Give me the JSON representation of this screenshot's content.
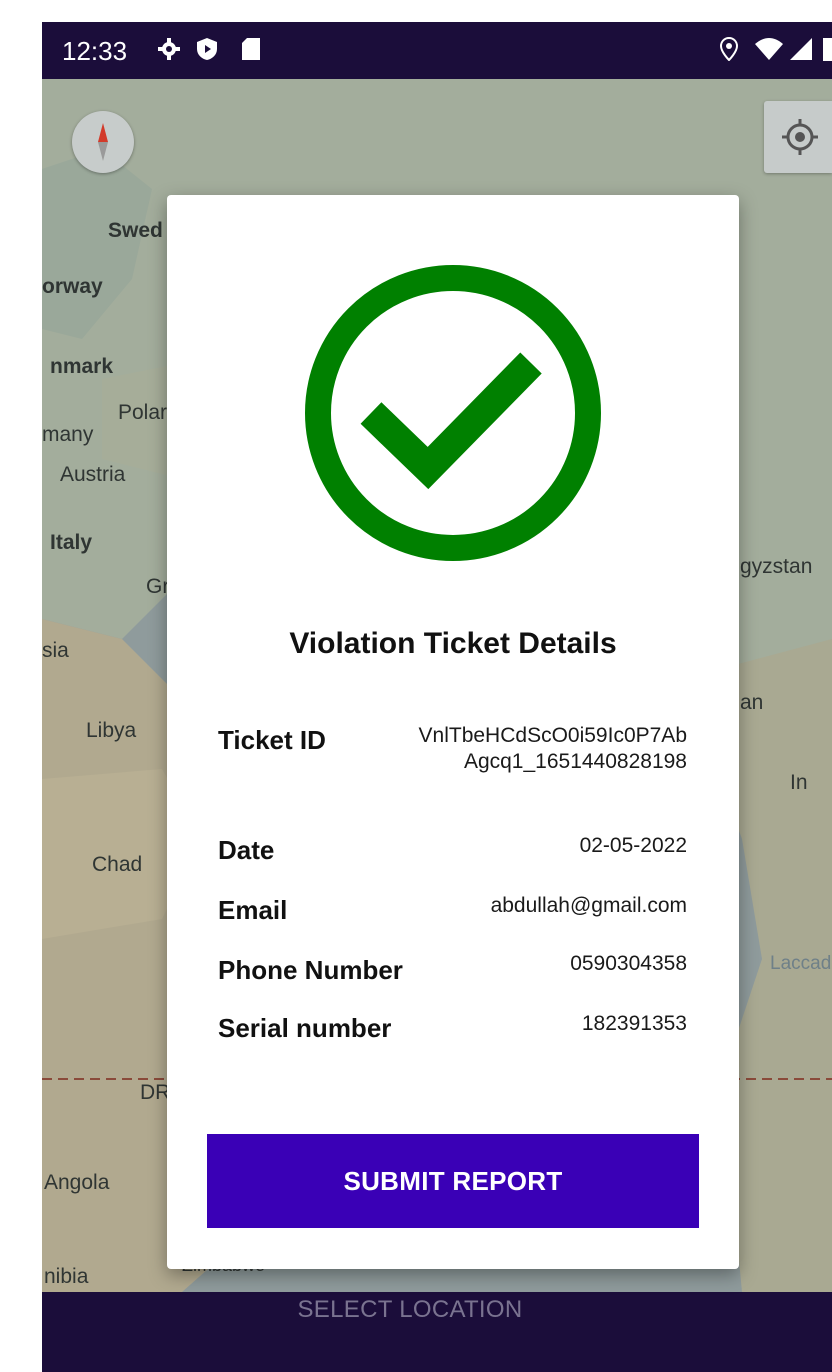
{
  "status_bar": {
    "time": "12:33",
    "icons": [
      "gear-icon",
      "shield-icon",
      "sd-card-icon",
      "location-icon",
      "wifi-icon",
      "signal-icon",
      "battery-icon"
    ]
  },
  "map": {
    "labels": [
      "Swed",
      "orway",
      "nmark",
      "Polar",
      "many",
      "Austria",
      "Italy",
      "Gr",
      "sia",
      "Libya",
      "Chad",
      "DR",
      "Angola",
      "nibia",
      "Zimbabwe",
      "gyzstan",
      "an",
      "In",
      "Laccad"
    ]
  },
  "dialog": {
    "title": "Violation Ticket Details",
    "rows": [
      {
        "label": "Ticket ID",
        "value": "VnlTbeHCdScO0i59Ic0P7AbAgcq1_1651440828198"
      },
      {
        "label": "Date",
        "value": "02-05-2022"
      },
      {
        "label": "Email",
        "value": "abdullah@gmail.com"
      },
      {
        "label": "Phone Number",
        "value": "0590304358"
      },
      {
        "label": "Serial number",
        "value": "182391353"
      }
    ],
    "submit_label": "SUBMIT REPORT",
    "success_color": "#008000",
    "button_color": "#3a00b6"
  },
  "bottom_bar": {
    "label": "SELECT LOCATION"
  }
}
